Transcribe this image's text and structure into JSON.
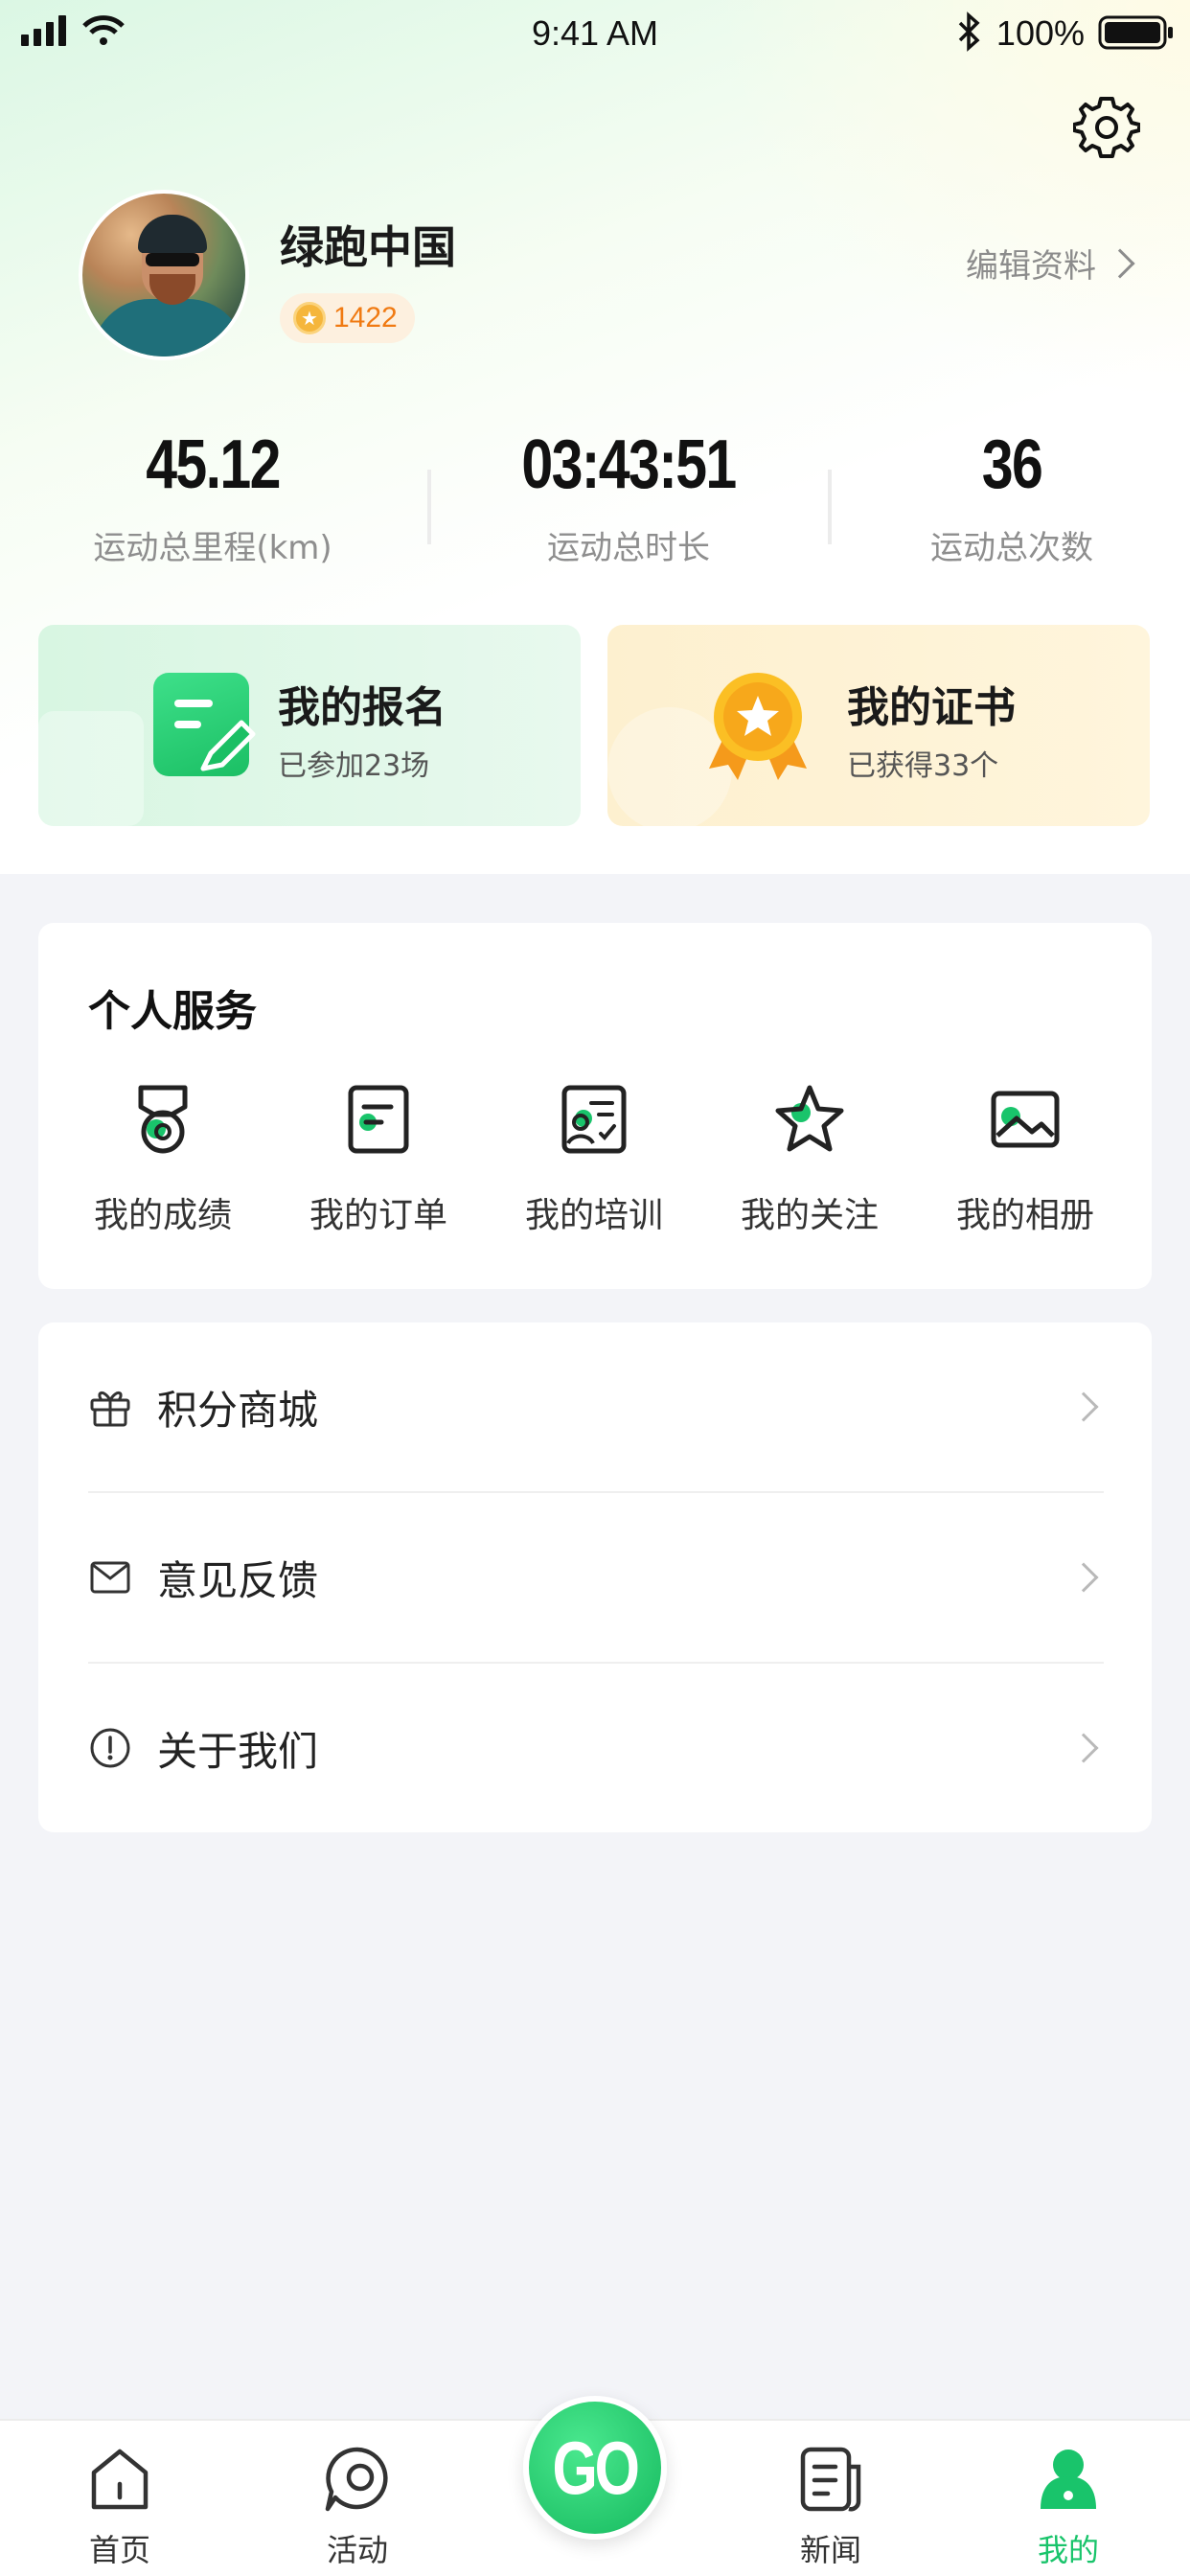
{
  "status_bar": {
    "time": "9:41 AM",
    "battery": "100%"
  },
  "profile": {
    "name": "绿跑中国",
    "points": "1422",
    "edit_label": "编辑资料"
  },
  "stats": [
    {
      "value": "45.12",
      "label": "运动总里程(km)"
    },
    {
      "value": "03:43:51",
      "label": "运动总时长"
    },
    {
      "value": "36",
      "label": "运动总次数"
    }
  ],
  "cards": {
    "signup": {
      "title": "我的报名",
      "subtitle": "已参加23场"
    },
    "certificate": {
      "title": "我的证书",
      "subtitle": "已获得33个"
    }
  },
  "services": {
    "heading": "个人服务",
    "items": [
      {
        "label": "我的成绩",
        "icon": "medal-icon"
      },
      {
        "label": "我的订单",
        "icon": "order-icon"
      },
      {
        "label": "我的培训",
        "icon": "training-icon"
      },
      {
        "label": "我的关注",
        "icon": "star-icon"
      },
      {
        "label": "我的相册",
        "icon": "album-icon"
      }
    ]
  },
  "menu": [
    {
      "label": "积分商城",
      "icon": "gift-icon"
    },
    {
      "label": "意见反馈",
      "icon": "mail-icon"
    },
    {
      "label": "关于我们",
      "icon": "info-icon"
    }
  ],
  "tabbar": {
    "items": [
      {
        "label": "首页",
        "icon": "home-icon"
      },
      {
        "label": "活动",
        "icon": "activity-icon"
      },
      {
        "label": "新闻",
        "icon": "news-icon"
      },
      {
        "label": "我的",
        "icon": "user-icon"
      }
    ],
    "go_label": "GO",
    "active": "我的"
  },
  "colors": {
    "accent": "#19c46b",
    "points": "#f07a12",
    "background": "#f3f4f8"
  }
}
